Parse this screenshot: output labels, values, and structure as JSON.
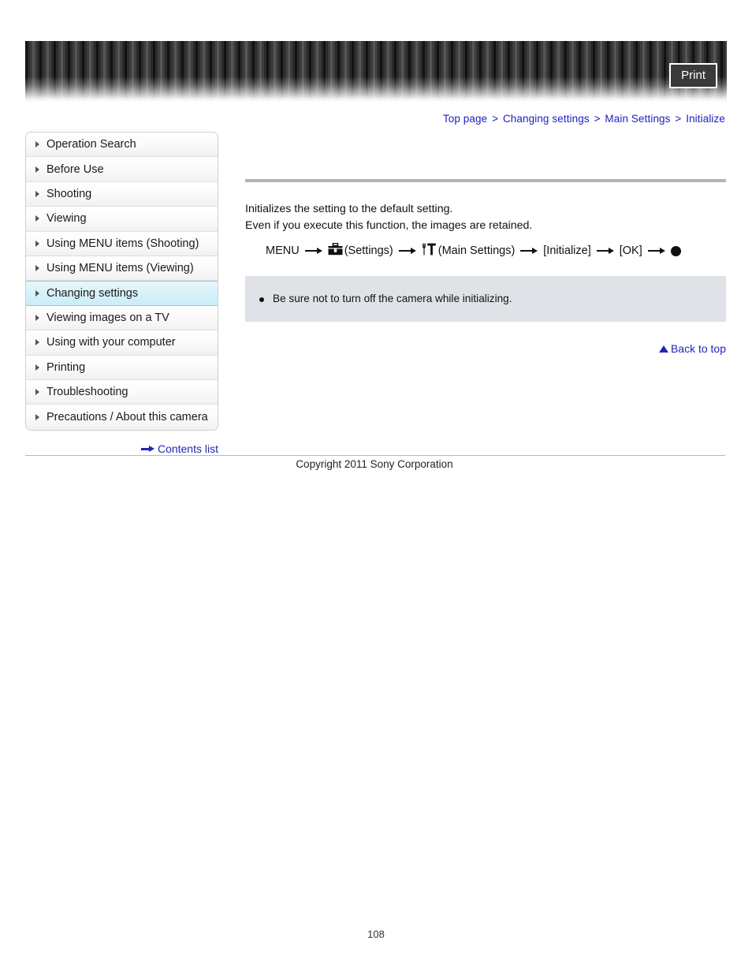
{
  "header": {
    "print_label": "Print"
  },
  "breadcrumb": {
    "separator": ">",
    "items": [
      {
        "label": "Top page"
      },
      {
        "label": "Changing settings"
      },
      {
        "label": "Main Settings"
      },
      {
        "label": "Initialize"
      }
    ]
  },
  "sidebar": {
    "items": [
      {
        "label": "Operation Search",
        "active": false
      },
      {
        "label": "Before Use",
        "active": false
      },
      {
        "label": "Shooting",
        "active": false
      },
      {
        "label": "Viewing",
        "active": false
      },
      {
        "label": "Using MENU items (Shooting)",
        "active": false
      },
      {
        "label": "Using MENU items (Viewing)",
        "active": false
      },
      {
        "label": "Changing settings",
        "active": true
      },
      {
        "label": "Viewing images on a TV",
        "active": false
      },
      {
        "label": "Using with your computer",
        "active": false
      },
      {
        "label": "Printing",
        "active": false
      },
      {
        "label": "Troubleshooting",
        "active": false
      },
      {
        "label": "Precautions / About this camera",
        "active": false
      }
    ],
    "contents_list_label": "Contents list"
  },
  "main": {
    "intro_line_1": "Initializes the setting to the default setting.",
    "intro_line_2": "Even if you execute this function, the images are retained.",
    "menu_path": {
      "menu_label": "MENU",
      "settings_label": "(Settings)",
      "main_settings_label": "(Main Settings)",
      "initialize_label": "[Initialize]",
      "ok_label": "[OK]"
    },
    "note": {
      "text": "Be sure not to turn off the camera while initializing."
    },
    "back_to_top_label": "Back to top"
  },
  "footer": {
    "copyright": "Copyright 2011 Sony Corporation",
    "page_number": "108"
  },
  "colors": {
    "link_blue": "#2424b8",
    "active_item": "#caeef7",
    "note_bg": "#dfe3e8",
    "rule_gray": "#b3b3b3"
  }
}
